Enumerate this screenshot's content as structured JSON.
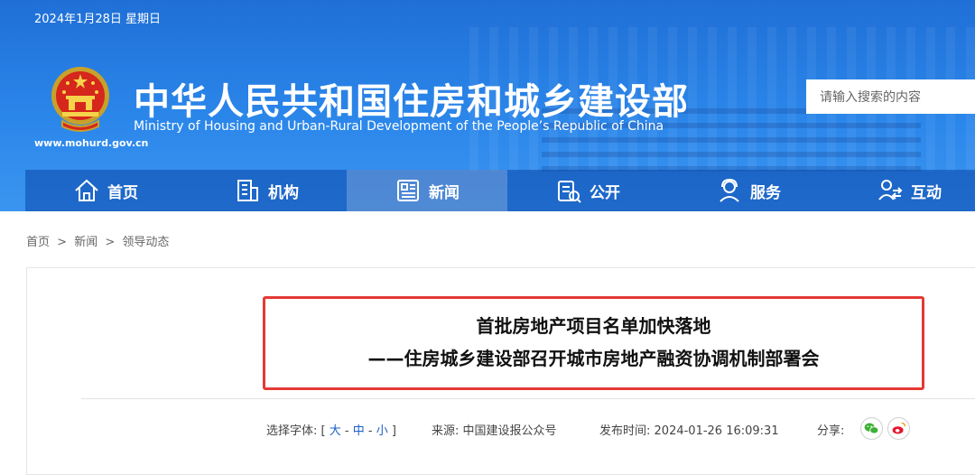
{
  "header": {
    "date": "2024年1月28日 星期日",
    "title_cn": "中华人民共和国住房和城乡建设部",
    "title_en": "Ministry of Housing and Urban-Rural Development of the People’s Republic of China",
    "site_url": "www.mohurd.gov.cn",
    "search_placeholder": "请输入搜索的内容"
  },
  "nav": {
    "items": [
      {
        "label": "首页",
        "icon": "home-icon"
      },
      {
        "label": "机构",
        "icon": "building-icon"
      },
      {
        "label": "新闻",
        "icon": "newspaper-icon",
        "active": true
      },
      {
        "label": "公开",
        "icon": "document-icon"
      },
      {
        "label": "服务",
        "icon": "user-service-icon"
      },
      {
        "label": "互动",
        "icon": "interaction-icon"
      }
    ]
  },
  "breadcrumb": [
    "首页",
    ">",
    "新闻",
    ">",
    "领导动态"
  ],
  "article": {
    "title_line1": "首批房地产项目名单加快落地",
    "title_line2": "——住房城乡建设部召开城市房地产融资协调机制部署会",
    "font_label": "选择字体:",
    "font_open": "[",
    "font_large": "大",
    "font_dash1": "-",
    "font_medium": "中",
    "font_dash2": "-",
    "font_small": "小",
    "font_close": "]",
    "source_label": "来源:",
    "source": "中国建设报公众号",
    "time_label": "发布时间:",
    "time": "2024-01-26 16:09:31",
    "share_label": "分享:"
  },
  "colors": {
    "header_blue": "#2b86ea",
    "highlight_border": "#e53935",
    "link_blue": "#1a5fc9"
  }
}
